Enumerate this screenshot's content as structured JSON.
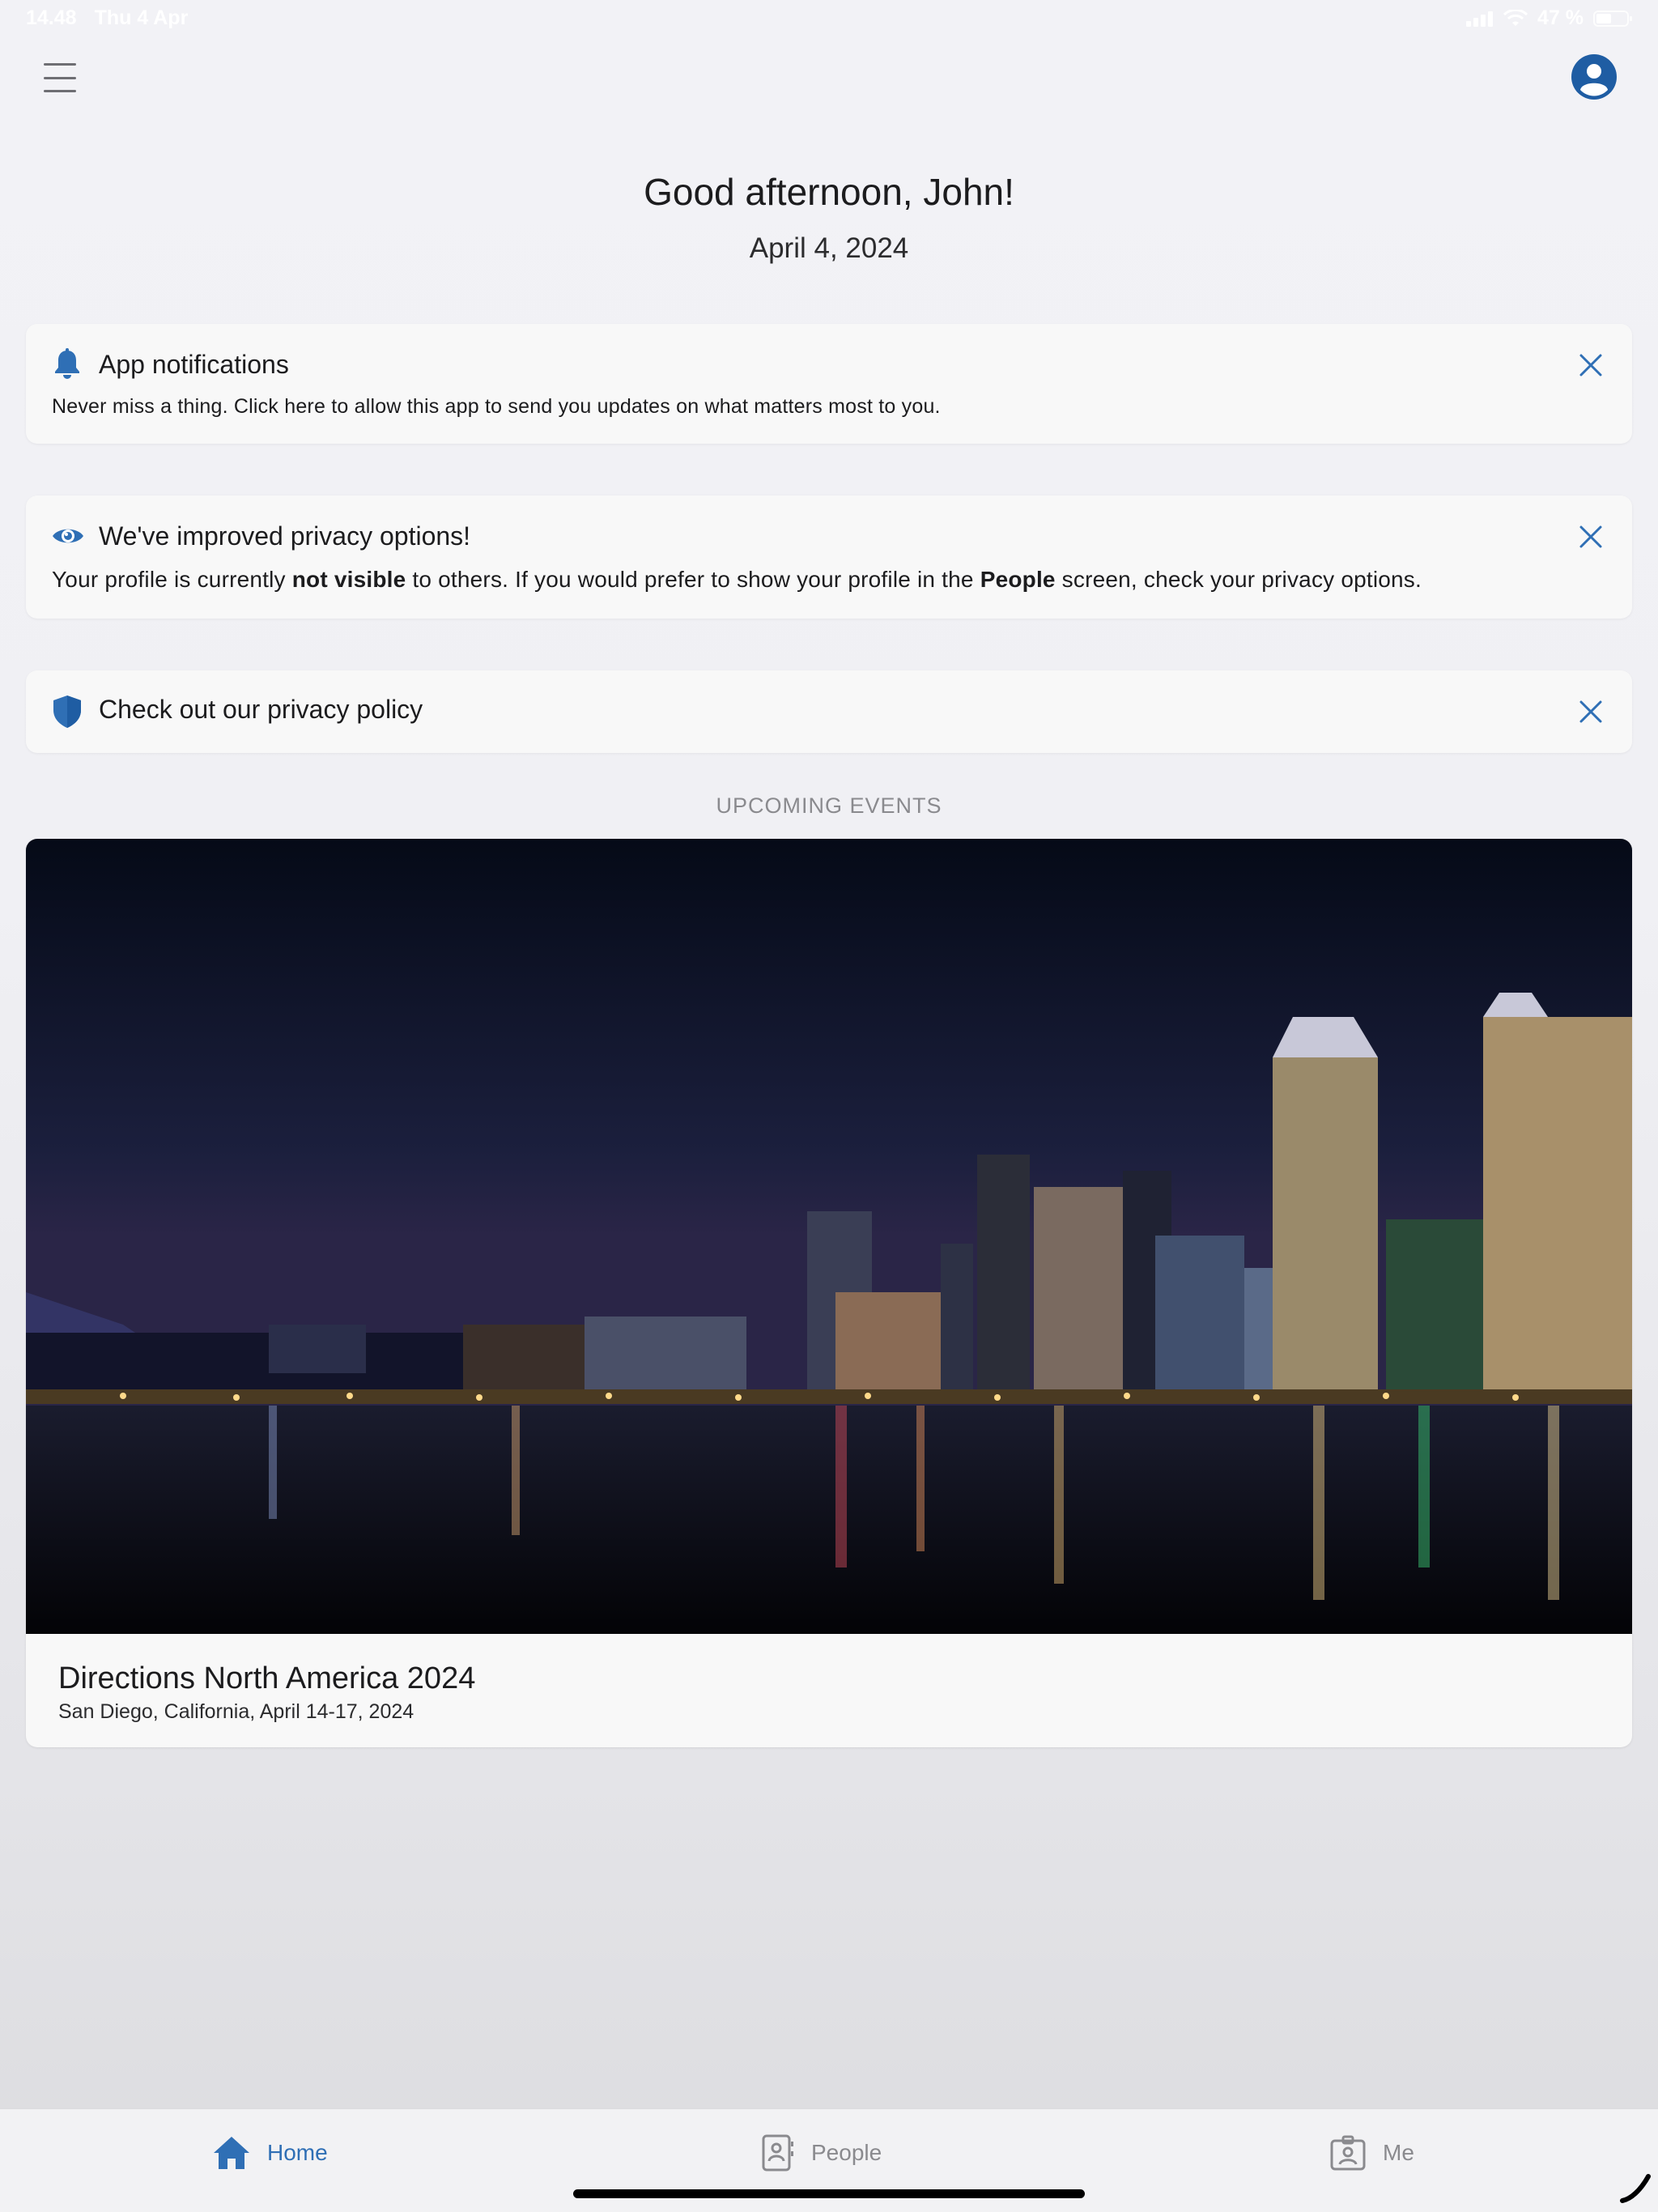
{
  "status_bar": {
    "time": "14.48",
    "date": "Thu 4 Apr",
    "battery": "47 %"
  },
  "header": {
    "greeting": "Good afternoon, John!",
    "date": "April 4, 2024"
  },
  "cards": {
    "notifications": {
      "title": "App notifications",
      "body": "Never miss a thing. Click here to allow this app to send you updates on what matters most to you."
    },
    "privacy": {
      "title": "We've improved privacy options!",
      "body_part1": "Your profile is currently ",
      "body_bold1": "not visible",
      "body_part2": " to others. If you would prefer to show your profile in the ",
      "body_bold2": "People",
      "body_part3": " screen, check your privacy options."
    },
    "policy": {
      "title": "Check out our privacy policy"
    }
  },
  "events": {
    "heading": "UPCOMING EVENTS",
    "items": [
      {
        "title": "Directions North America 2024",
        "subtitle": "San Diego, California, April 14-17, 2024"
      }
    ]
  },
  "tabs": [
    {
      "label": "Home",
      "active": true
    },
    {
      "label": "People",
      "active": false
    },
    {
      "label": "Me",
      "active": false
    }
  ],
  "colors": {
    "accent": "#2f6fb5",
    "card_bg": "#f8f8f8",
    "inactive_tab": "#8a8a8e"
  }
}
